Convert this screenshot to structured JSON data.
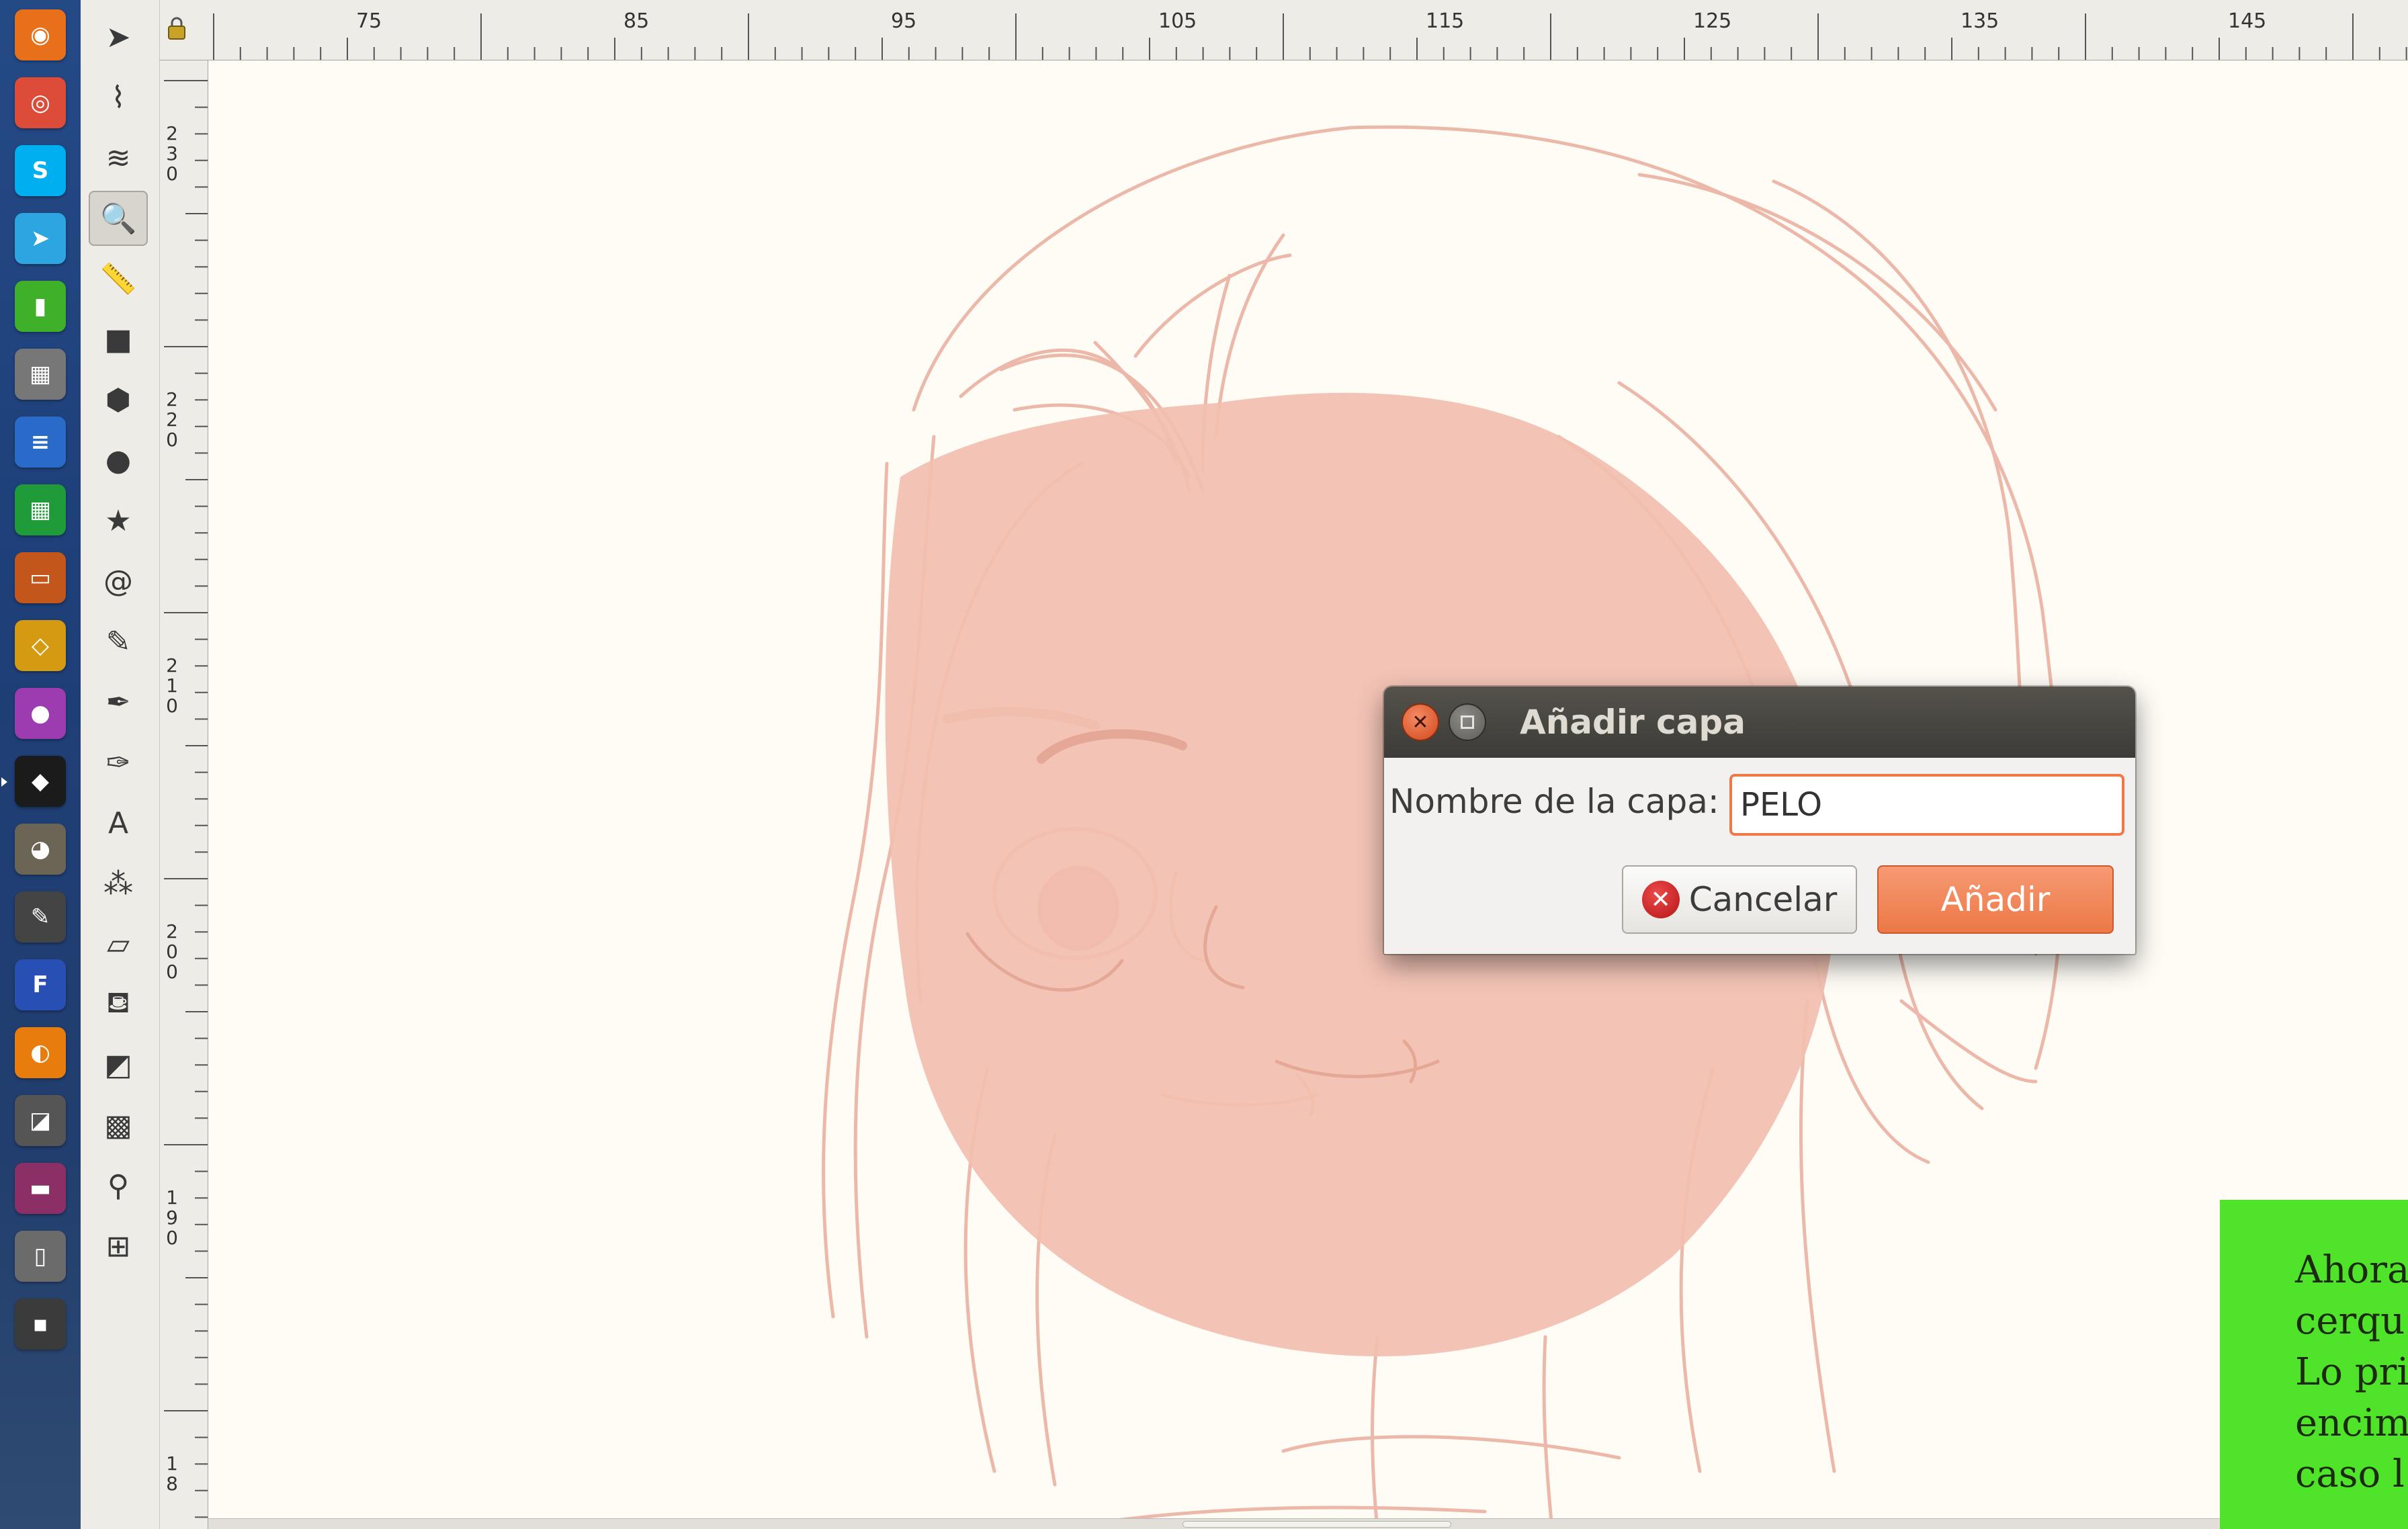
{
  "launcher": {
    "items": [
      {
        "name": "firefox",
        "icon": "firefox-icon",
        "color": "#e8701a",
        "glyph": "◉"
      },
      {
        "name": "chrome",
        "icon": "chrome-icon",
        "color": "#dd4b39",
        "glyph": "◎"
      },
      {
        "name": "skype",
        "icon": "skype-icon",
        "color": "#00aff0",
        "glyph": "S"
      },
      {
        "name": "telegram",
        "icon": "telegram-icon",
        "color": "#2ca5e0",
        "glyph": "➤"
      },
      {
        "name": "app-green",
        "icon": "green-jar-icon",
        "color": "#3fb02a",
        "glyph": "▮"
      },
      {
        "name": "calculator",
        "icon": "calculator-icon",
        "color": "#777",
        "glyph": "▦"
      },
      {
        "name": "writer",
        "icon": "writer-icon",
        "color": "#2a6ac8",
        "glyph": "≡"
      },
      {
        "name": "calc",
        "icon": "spreadsheet-icon",
        "color": "#1f9b3a",
        "glyph": "▦"
      },
      {
        "name": "impress",
        "icon": "presentation-icon",
        "color": "#c2561b",
        "glyph": "▭"
      },
      {
        "name": "draw",
        "icon": "draw-icon",
        "color": "#d49b12",
        "glyph": "◇"
      },
      {
        "name": "app-sphere",
        "icon": "sphere-icon",
        "color": "#9d3bb1",
        "glyph": "●"
      },
      {
        "name": "inkscape",
        "icon": "inkscape-icon",
        "color": "#1b1b1b",
        "glyph": "◆"
      },
      {
        "name": "gimp",
        "icon": "gimp-icon",
        "color": "#6b6555",
        "glyph": "◕"
      },
      {
        "name": "app-pencil",
        "icon": "pencil-app-icon",
        "color": "#444",
        "glyph": "✎"
      },
      {
        "name": "fontforge",
        "icon": "fontforge-icon",
        "color": "#2850b4",
        "glyph": "F"
      },
      {
        "name": "blender",
        "icon": "blender-icon",
        "color": "#e87d0d",
        "glyph": "◐"
      },
      {
        "name": "app-scan",
        "icon": "scanner-icon",
        "color": "#555",
        "glyph": "◪"
      },
      {
        "name": "app-window",
        "icon": "window-app-icon",
        "color": "#8c2f66",
        "glyph": "▬"
      },
      {
        "name": "app-device",
        "icon": "device-icon",
        "color": "#6b6b6b",
        "glyph": "▯"
      },
      {
        "name": "app-drive",
        "icon": "drive-icon",
        "color": "#3b3b3b",
        "glyph": "▪"
      }
    ]
  },
  "toolbox": {
    "tools": [
      {
        "name": "selector",
        "icon": "arrow-pointer-icon",
        "glyph": "➤"
      },
      {
        "name": "node",
        "icon": "node-edit-icon",
        "glyph": "⌇"
      },
      {
        "name": "tweak",
        "icon": "tweak-icon",
        "glyph": "≋"
      },
      {
        "name": "zoom",
        "icon": "magnifier-icon",
        "glyph": "🔍"
      },
      {
        "name": "measure",
        "icon": "ruler-icon",
        "glyph": "📏"
      },
      {
        "name": "rectangle",
        "icon": "rectangle-icon",
        "glyph": "■"
      },
      {
        "name": "box3d",
        "icon": "cube-icon",
        "glyph": "⬢"
      },
      {
        "name": "ellipse",
        "icon": "circle-icon",
        "glyph": "●"
      },
      {
        "name": "star",
        "icon": "star-icon",
        "glyph": "★"
      },
      {
        "name": "spiral",
        "icon": "spiral-icon",
        "glyph": "@"
      },
      {
        "name": "pencil",
        "icon": "pencil-icon",
        "glyph": "✎"
      },
      {
        "name": "pen",
        "icon": "pen-icon",
        "glyph": "✒"
      },
      {
        "name": "calligraphy",
        "icon": "calligraphy-icon",
        "glyph": "✑"
      },
      {
        "name": "text",
        "icon": "text-tool-icon",
        "glyph": "A"
      },
      {
        "name": "spray",
        "icon": "spray-icon",
        "glyph": "⁂"
      },
      {
        "name": "eraser",
        "icon": "eraser-icon",
        "glyph": "▱"
      },
      {
        "name": "paint-bucket",
        "icon": "bucket-icon",
        "glyph": "⛾"
      },
      {
        "name": "gradient",
        "icon": "gradient-icon",
        "glyph": "◩"
      },
      {
        "name": "mesh",
        "icon": "mesh-icon",
        "glyph": "▩"
      },
      {
        "name": "dropper",
        "icon": "dropper-icon",
        "glyph": "⚲"
      },
      {
        "name": "connector",
        "icon": "connector-icon",
        "glyph": "⊞"
      }
    ],
    "active": "zoom"
  },
  "ruler": {
    "horizontal": [
      "75",
      "85",
      "95",
      "105",
      "115",
      "125",
      "135",
      "145"
    ],
    "vertical": [
      [
        "2",
        "3",
        "0"
      ],
      [
        "2",
        "2",
        "0"
      ],
      [
        "2",
        "1",
        "0"
      ],
      [
        "2",
        "0",
        "0"
      ],
      [
        "1",
        "9",
        "0"
      ],
      [
        "1",
        "8"
      ]
    ]
  },
  "dialog": {
    "title": "Añadir capa",
    "name_label": "Nombre de la capa:",
    "name_value": "PELO",
    "cancel_label": "Cancelar",
    "add_label": "Añadir",
    "accent": "#f07746"
  },
  "note": {
    "lines": [
      "Ahora",
      "cerqu",
      "Lo pri",
      "encim",
      "caso l"
    ],
    "color": "#4fe32a"
  }
}
